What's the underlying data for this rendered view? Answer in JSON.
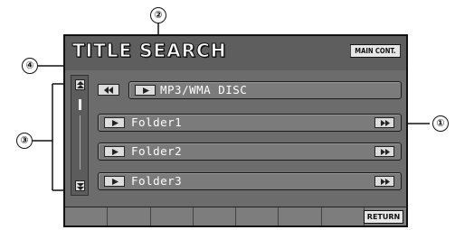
{
  "header": {
    "title": "TITLE SEARCH",
    "main_cont_label": "MAIN CONT."
  },
  "disc": {
    "label": "MP3/WMA DISC",
    "back_icon": "double-left-arrow",
    "play_icon": "play-triangle"
  },
  "folders": [
    {
      "label": "Folder1",
      "next_icon": "double-right-arrow"
    },
    {
      "label": "Folder2",
      "next_icon": "double-right-arrow"
    },
    {
      "label": "Folder3",
      "next_icon": "double-right-arrow"
    }
  ],
  "footer": {
    "return_label": "RETURN"
  },
  "callouts": {
    "c1": "①",
    "c2": "②",
    "c3": "③",
    "c4": "④"
  }
}
